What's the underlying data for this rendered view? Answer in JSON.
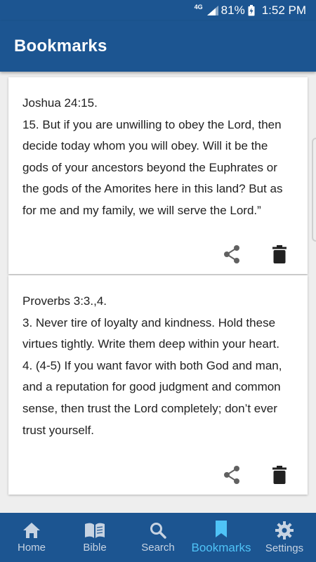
{
  "status_bar": {
    "network": "4G",
    "battery": "81%",
    "time": "1:52 PM"
  },
  "app_bar": {
    "title": "Bookmarks"
  },
  "bookmarks": [
    {
      "reference": "Joshua 24:15.",
      "verses": [
        "15. But if you are unwilling to obey the Lord, then decide today whom you will obey. Will it be the gods of your ancestors beyond the Euphrates or the gods of the Amorites here in this land? But as for me and my family, we will serve the Lord.”"
      ],
      "share_icon": "share-icon",
      "delete_icon": "trash-icon"
    },
    {
      "reference": "Proverbs 3:3.,4.",
      "verses": [
        "3. Never tire of loyalty and kindness. Hold these virtues tightly. Write them deep within your heart.",
        "4. (4-5) If you want favor with both God and man, and a reputation for good judgment and common sense, then trust the Lord completely; don’t ever trust yourself."
      ],
      "share_icon": "share-icon",
      "delete_icon": "trash-icon"
    }
  ],
  "bottom_nav": {
    "items": [
      {
        "label": "Home",
        "icon": "home-icon",
        "active": false
      },
      {
        "label": "Bible",
        "icon": "book-icon",
        "active": false
      },
      {
        "label": "Search",
        "icon": "search-icon",
        "active": false
      },
      {
        "label": "Bookmarks",
        "icon": "bookmark-icon",
        "active": true
      },
      {
        "label": "Settings",
        "icon": "gear-icon",
        "active": false
      }
    ]
  },
  "colors": {
    "primary": "#1c5591",
    "active_nav": "#4fc3f7",
    "inactive_nav": "#c7d3e2",
    "background": "#eeeeee"
  }
}
